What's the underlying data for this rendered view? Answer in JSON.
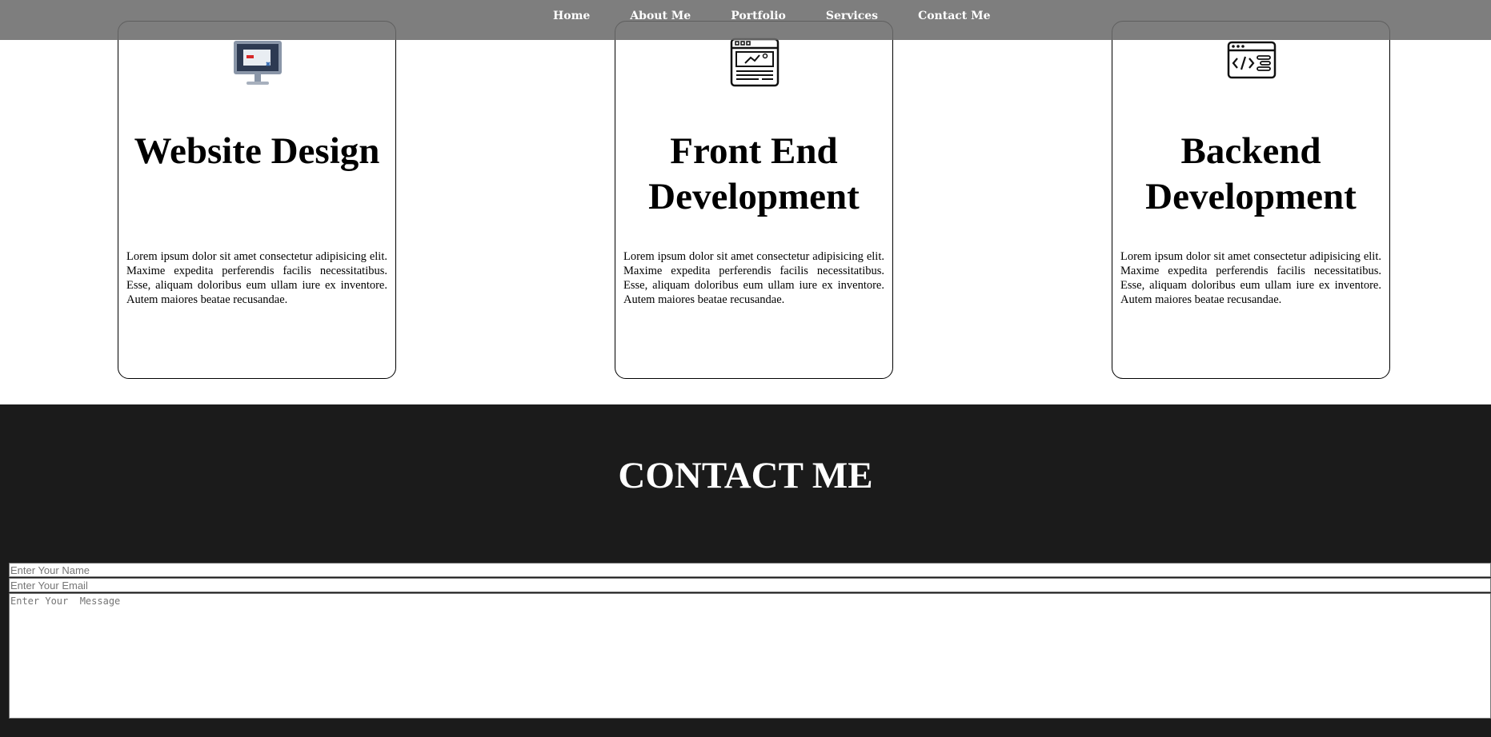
{
  "nav": {
    "items": [
      "Home",
      "About Me",
      "Portfolio",
      "Services",
      "Contact Me"
    ]
  },
  "services": {
    "cards": [
      {
        "icon": "monitor-icon",
        "title": "Website Design",
        "text": "Lorem ipsum dolor sit amet consectetur adipisicing elit. Maxime expedita perferendis facilis necessitatibus. Esse, aliquam doloribus eum ullam iure ex inventore. Autem maiores beatae recusandae."
      },
      {
        "icon": "browser-layout-icon",
        "title": "Front End Development",
        "text": "Lorem ipsum dolor sit amet consectetur adipisicing elit. Maxime expedita perferendis facilis necessitatibus. Esse, aliquam doloribus eum ullam iure ex inventore. Autem maiores beatae recusandae."
      },
      {
        "icon": "code-window-icon",
        "title": "Backend Development",
        "text": "Lorem ipsum dolor sit amet consectetur adipisicing elit. Maxime expedita perferendis facilis necessitatibus. Esse, aliquam doloribus eum ullam iure ex inventore. Autem maiores beatae recusandae."
      }
    ]
  },
  "contact": {
    "title": "CONTACT ME",
    "name_placeholder": "Enter Your Name",
    "email_placeholder": "Enter Your Email",
    "message_placeholder": "Enter Your  Message"
  },
  "colors": {
    "navbar": "#6c6c6c",
    "contact_background": "#1b1b1b",
    "card_border": "#000000"
  }
}
